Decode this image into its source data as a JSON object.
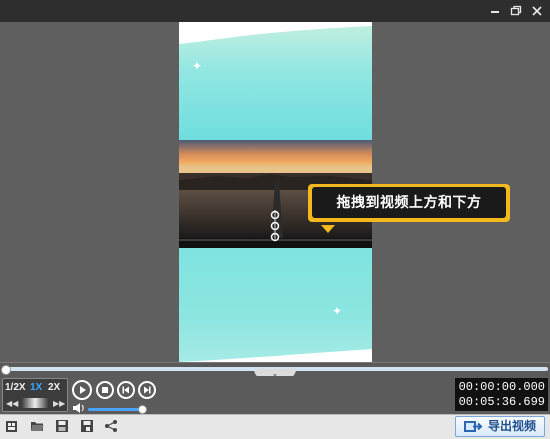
{
  "window": {
    "minimize_icon": "minimize-icon",
    "restore_icon": "restore-icon",
    "close_icon": "close-icon"
  },
  "preview": {
    "tooltip_text": "拖拽到视频上方和下方",
    "colors": {
      "tooltip_border": "#f3b81c",
      "tooltip_bg": "#1a1a1a",
      "backdrop": "#7fe3e0"
    }
  },
  "timeline": {
    "position": 0.0,
    "collapse_icon": "chevron-down-icon"
  },
  "playback": {
    "speeds": [
      "1/2X",
      "1X",
      "2X"
    ],
    "active_speed": "1X",
    "volume": 0.95,
    "current_time": "00:00:00.000",
    "total_time": "00:05:36.699"
  },
  "toolbar": {
    "export_label": "导出视频",
    "icons": [
      "new-project-icon",
      "open-folder-icon",
      "save-icon",
      "save-as-icon",
      "share-icon"
    ]
  }
}
